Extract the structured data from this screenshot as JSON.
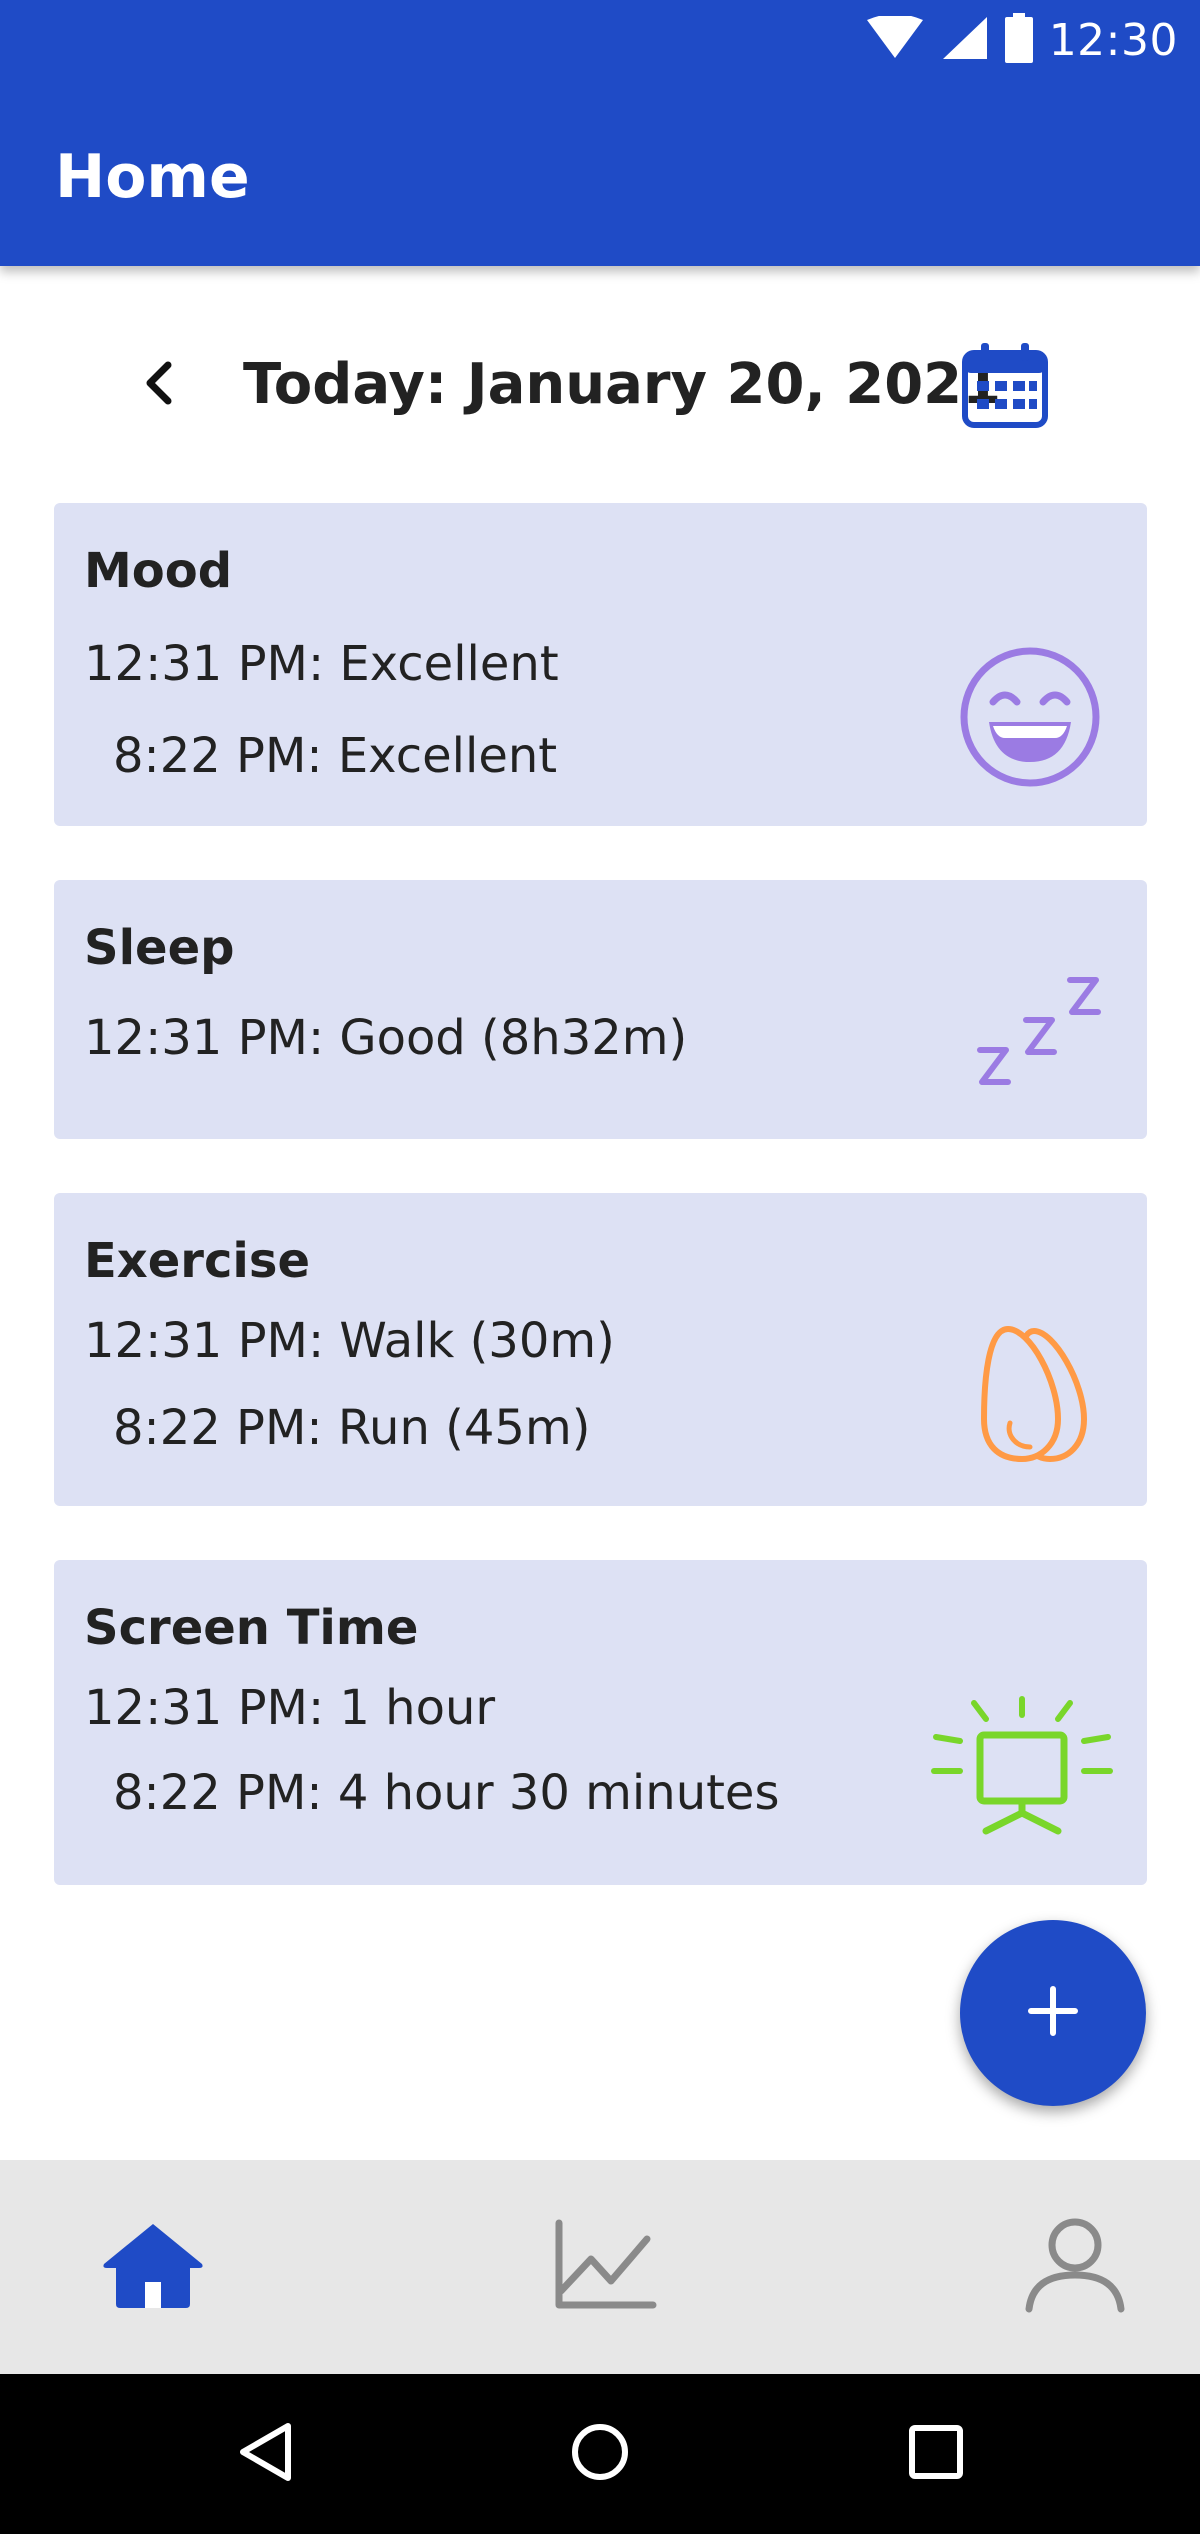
{
  "status_bar": {
    "time": "12:30",
    "icons": [
      "wifi-icon",
      "signal-icon",
      "battery-icon"
    ]
  },
  "app_bar": {
    "title": "Home"
  },
  "date_nav": {
    "label": "Today: January 20, 2021",
    "prev_icon": "chevron-left-icon",
    "calendar_icon": "calendar-icon"
  },
  "cards": {
    "mood": {
      "title": "Mood",
      "entries": [
        "12:31 PM: Excellent",
        "8:22 PM: Excellent"
      ],
      "icon": "laughing-face-icon",
      "icon_color": "#9b7be3"
    },
    "sleep": {
      "title": "Sleep",
      "entries": [
        "12:31 PM: Good (8h32m)"
      ],
      "icon": "zzz-icon",
      "icon_color": "#9b7be3"
    },
    "exercise": {
      "title": "Exercise",
      "entries": [
        "12:31 PM: Walk (30m)",
        "8:22 PM: Run (45m)"
      ],
      "icon": "footprints-icon",
      "icon_color": "#ff9a45"
    },
    "screen_time": {
      "title": "Screen Time",
      "entries": [
        "12:31 PM: 1 hour",
        "8:22 PM: 4 hour 30 minutes"
      ],
      "icon": "tv-icon",
      "icon_color": "#79d62a"
    }
  },
  "fab": {
    "icon": "plus-icon"
  },
  "bottom_nav": {
    "items": [
      {
        "name": "home",
        "icon": "home-icon",
        "active": true
      },
      {
        "name": "stats",
        "icon": "chart-icon",
        "active": false
      },
      {
        "name": "profile",
        "icon": "person-icon",
        "active": false
      }
    ]
  },
  "system_nav": {
    "icons": [
      "back-icon",
      "home-circle-icon",
      "recents-icon"
    ]
  },
  "colors": {
    "primary": "#1f4bc6",
    "card_bg": "#dde1f4",
    "nav_bg": "#e7e7e7",
    "inactive_icon": "#8a8a8a"
  }
}
